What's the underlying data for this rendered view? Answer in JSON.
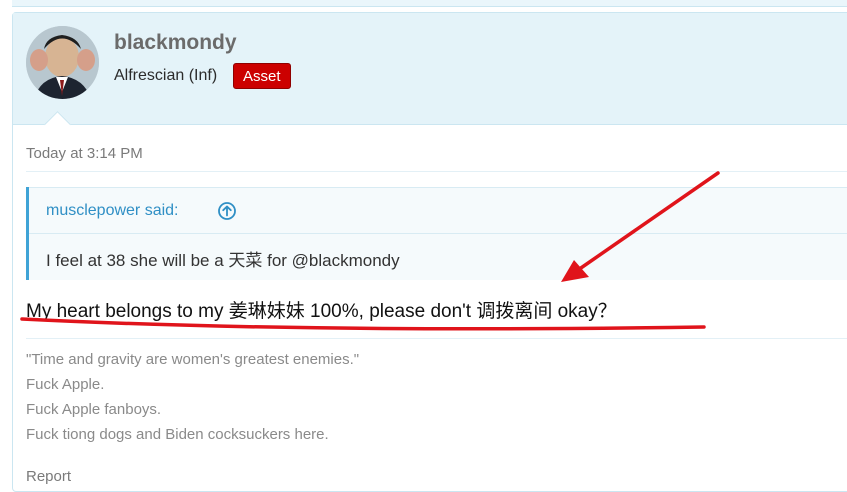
{
  "post": {
    "username": "blackmondy",
    "user_title": "Alfrescian (Inf)",
    "user_badge": "Asset",
    "timestamp": "Today at 3:14 PM",
    "quote": {
      "author_label": "musclepower said:",
      "expand_icon": "arrow-up-circle-icon",
      "text": "I feel at 38 she will be a 天菜 for @blackmondy"
    },
    "message": "My heart belongs to my 姜琳妹妹 100%, please don't 调拨离间 okay？",
    "signature": [
      "\"Time and gravity are women's greatest enemies.\"",
      "Fuck Apple.",
      "Fuck Apple fanboys.",
      "Fuck tiong dogs and Biden cocksuckers here."
    ],
    "report_label": "Report"
  },
  "colors": {
    "header_bg": "#e4f3f9",
    "border": "#cbe6f1",
    "quote_accent": "#3fa3d6",
    "quote_author": "#2f8fc5",
    "badge_bg": "#cc0000",
    "annotation_red": "#e0141b"
  },
  "annotation": {
    "type": "red-arrow-and-underline"
  }
}
